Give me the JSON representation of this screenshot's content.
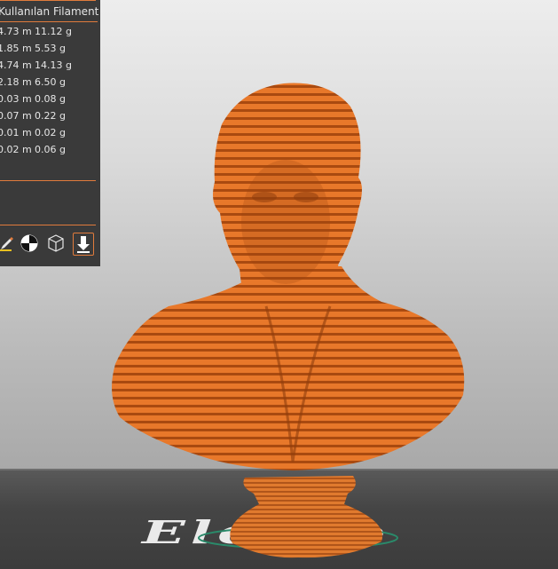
{
  "panel": {
    "header": "Kullanılan Filament",
    "rows": [
      {
        "length": "4.73 m",
        "weight": "11.12 g"
      },
      {
        "length": "1.85 m",
        "weight": "5.53 g"
      },
      {
        "length": "4.74 m",
        "weight": "14.13 g"
      },
      {
        "length": "2.18 m",
        "weight": "6.50 g"
      },
      {
        "length": "0.03 m",
        "weight": "0.08 g"
      },
      {
        "length": "0.07 m",
        "weight": "0.22 g"
      },
      {
        "length": "0.01 m",
        "weight": "0.02 g"
      },
      {
        "length": "0.02 m",
        "weight": "0.06 g"
      }
    ]
  },
  "toolbar": {
    "tools": [
      "paint-tool-icon",
      "center-view-icon",
      "wireframe-cube-icon",
      "export-icon"
    ]
  },
  "bed": {
    "logo_text": "Elegoo"
  },
  "colors": {
    "accent": "#e07b3c",
    "model": "#e8782a",
    "panel_bg": "#3a3a3a"
  }
}
